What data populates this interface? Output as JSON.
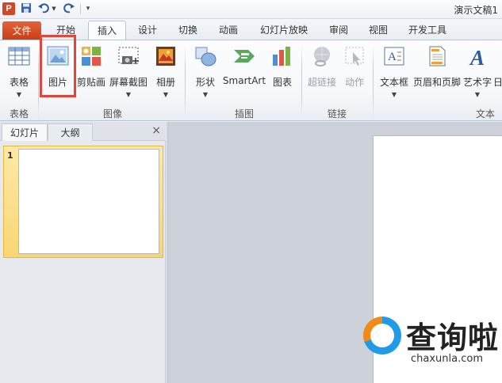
{
  "app": {
    "icon_letter": "P",
    "document_title": "演示文稿1"
  },
  "quick_access": {
    "save_icon": "save-icon",
    "undo_icon": "undo-icon",
    "redo_icon": "redo-icon",
    "customize_icon": "customize-qat-icon"
  },
  "tabs": [
    {
      "label": "文件"
    },
    {
      "label": "开始"
    },
    {
      "label": "插入"
    },
    {
      "label": "设计"
    },
    {
      "label": "切换"
    },
    {
      "label": "动画"
    },
    {
      "label": "幻灯片放映"
    },
    {
      "label": "审阅"
    },
    {
      "label": "视图"
    },
    {
      "label": "开发工具"
    }
  ],
  "active_tab": "插入",
  "ribbon": {
    "groups": [
      {
        "label": "表格"
      },
      {
        "label": "图像"
      },
      {
        "label": "插图"
      },
      {
        "label": "链接"
      },
      {
        "label": "文本"
      }
    ],
    "buttons": {
      "table": {
        "label": "表格"
      },
      "picture": {
        "label": "图片"
      },
      "clipart": {
        "label": "剪贴画"
      },
      "screenshot": {
        "label": "屏幕截图"
      },
      "album": {
        "label": "相册"
      },
      "shapes": {
        "label": "形状"
      },
      "smartart": {
        "label": "SmartArt"
      },
      "chart": {
        "label": "图表"
      },
      "hyperlink": {
        "label": "超链接"
      },
      "action": {
        "label": "动作"
      },
      "textbox": {
        "label": "文本框"
      },
      "header_footer": {
        "label": "页眉和页脚"
      },
      "wordart": {
        "label": "艺术字"
      },
      "date": {
        "label": "日"
      }
    }
  },
  "left_pane": {
    "tabs": [
      {
        "label": "幻灯片"
      },
      {
        "label": "大纲"
      }
    ],
    "close": "×",
    "slides": [
      {
        "number": "1"
      }
    ]
  },
  "watermark": {
    "title": "查询啦",
    "url": "chaxunla.com"
  },
  "colors": {
    "file_tab": "#d24726",
    "highlight": "#e0463c",
    "selected_thumb": "#f8d673",
    "accent": "#2c5aa0"
  }
}
